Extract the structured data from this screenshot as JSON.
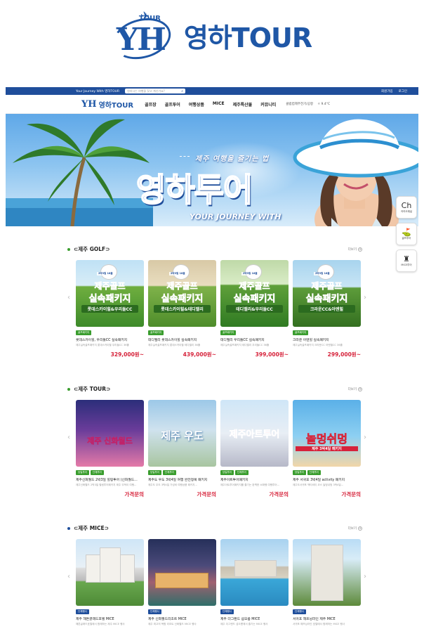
{
  "logo": {
    "mini": "YH",
    "tour_small": "TOUR",
    "brand": "영하TOUR"
  },
  "topbar": {
    "tagline": "Your Journey With 영하TOUR",
    "search_placeholder": "원하시는 여행을 찾고 계신가요?",
    "links": [
      "회원가입",
      "로그인"
    ]
  },
  "nav": {
    "brand": "영하TOUR",
    "items": [
      "골프장",
      "골프투어",
      "여행상품",
      "MICE",
      "제주특산물",
      "커뮤니티"
    ],
    "right_text": "클럽컵제주전기/공항",
    "weather": "☼ 9.4°C"
  },
  "hero": {
    "caption": "제주 여행을 즐기는 법",
    "headline": "영하투어",
    "sub": "YOUR JOURNEY WITH"
  },
  "floating": [
    {
      "icon": "Ch",
      "label": "카카오채널"
    },
    {
      "icon": "⛳",
      "label": "골프투어"
    },
    {
      "icon": "♜",
      "label": "MICE투어"
    }
  ],
  "more_label": "더보기",
  "golf": {
    "title": "⊂제주 GOLF⊃",
    "cards": [
      {
        "top": "2박3일 18홀",
        "line1": "제주골프",
        "line2": "실속패키지",
        "course": "롯데스카이힐&우리들CC",
        "badges": [
          "골프패키지"
        ],
        "title": "롯데스카이힐, 우리들CC 실속패키지",
        "desc": "제주실속골프패키지 롯데스카이힐 우리들CC 36홀",
        "price": "329,000원~"
      },
      {
        "top": "2박3일 18홀",
        "line1": "제주골프",
        "line2": "실속패키지",
        "course": "롯데스카이힐&테디밸리",
        "badges": [
          "골프패키지"
        ],
        "title": "테디밸리 롯데스카이힐 실속패키지",
        "desc": "제주실속골프패키지 롯데스카이힐 테디밸리 36홀",
        "price": "439,000원~"
      },
      {
        "top": "2박3일 18홀",
        "line1": "제주골프",
        "line2": "실속패키지",
        "course": "테디밸리&우리들CC",
        "badges": [
          "골프패키지"
        ],
        "title": "테디밸리 우리들CC 실속패키지",
        "desc": "제주실속골프패키지 테디밸리 우리들CC 36홀",
        "price": "399,000원~"
      },
      {
        "top": "2박3일 18홀",
        "line1": "제주골프",
        "line2": "실속패키지",
        "course": "크라운CC&아덴힐",
        "badges": [
          "골프패키지"
        ],
        "title": "크라운 아덴힐 실속패키지",
        "desc": "제주실속골프패키지 크라운CC 아덴힐CC 36홀",
        "price": "299,000원~"
      }
    ]
  },
  "tour": {
    "title": "⊂제주 TOUR⊃",
    "cards": [
      {
        "img": "제주 신화월드",
        "badges": [
          "당일투어",
          "단체투어"
        ],
        "title": "제주신화월드 2박3일 힐링투어 (신화월드...",
        "desc": "제주신화월드 2박3일 힐링투어패키지 제주 뚜벅이 여행...",
        "price": "가격문의"
      },
      {
        "img": "제주 우도",
        "badges": [
          "당일투어",
          "단체투어"
        ],
        "title": "제주도 우도 3박4일 여행 완전정복 패키지",
        "desc": "제주도 우도 3박4일 가성비 여행상품 패키지...",
        "price": "가격문의"
      },
      {
        "img": "제주아트투어",
        "badges": [
          "당일투어",
          "단체투어"
        ],
        "title": "제주아트투어패키지",
        "desc": "제주아트투어패키지를 즐기는 완벽한 소확행 여행투어...",
        "price": "가격문의"
      },
      {
        "img": "놀멍쉬멍",
        "img_sub": "제주 3박4일 패키지",
        "badges": [
          "당일투어",
          "단체투어"
        ],
        "title": "제주 서귀포 3박4일 activity 패키지",
        "desc": "제주도서귀포 액티비티 코스 놀멍쉬멍 3박4일...",
        "price": "가격문의"
      }
    ]
  },
  "mice": {
    "title": "⊂제주 MICE⊃",
    "cards": [
      {
        "badges": [
          "단체행사"
        ],
        "title": "제주 해튼글래드호텔 MICE",
        "desc": "해튼글래드호텔에서 함께하는 제주 MICE 행사"
      },
      {
        "badges": [
          "단체행사"
        ],
        "title": "제주 신화월드리조트 MICE",
        "desc": "제주 최고의 복합 리조트 신화월드 MICE 행사"
      },
      {
        "badges": [
          "단체행사"
        ],
        "title": "제주 더그랜드 섬오름 MICE",
        "desc": "제주 더그랜드 섬오름에서 즐기는 MICE 행사"
      },
      {
        "badges": [
          "단체행사"
        ],
        "title": "서귀포 해프닝라인 제주 MICE",
        "desc": "서귀포 해프닝라인 호텔에서 함께하는 MICE 행사"
      }
    ]
  }
}
